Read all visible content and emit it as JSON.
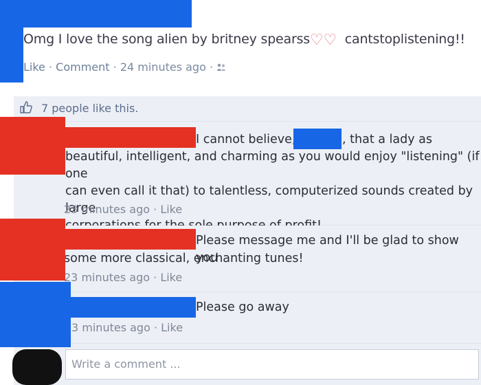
{
  "post": {
    "text_before": "Omg I love the song alien by britney spearss",
    "text_after": "cantstoplistening!!",
    "meta": {
      "like": "Like",
      "comment": "Comment",
      "time": "24 minutes ago"
    }
  },
  "likes": {
    "text": "7 people like this."
  },
  "comments": [
    {
      "lines": [
        "I cannot believe,",
        ", that a lady as",
        "beautiful, intelligent, and charming as you would enjoy \"listening\" (if one",
        "can even call it that) to talentless, computerized sounds created by large",
        "corporations for the sole purpose of profit!"
      ],
      "time": "23 minutes ago",
      "like": "Like"
    },
    {
      "lines": [
        "Please message me and I'll be glad to show you",
        "some more classical, enchanting tunes!"
      ],
      "time": "23 minutes ago",
      "like": "Like"
    },
    {
      "lines": [
        "Please go away"
      ],
      "time": "3 minutes ago",
      "like": "Like"
    }
  ],
  "composer": {
    "placeholder": "Write a comment ..."
  },
  "icons": {
    "heart": "heart-icon",
    "thumb": "thumbs-up-icon",
    "audience": "friends-audience-icon"
  },
  "colors": {
    "redaction_blue": "#1766e6",
    "redaction_red": "#e43123",
    "panel_bg": "#eceff5",
    "link": "#6d7f9a"
  }
}
